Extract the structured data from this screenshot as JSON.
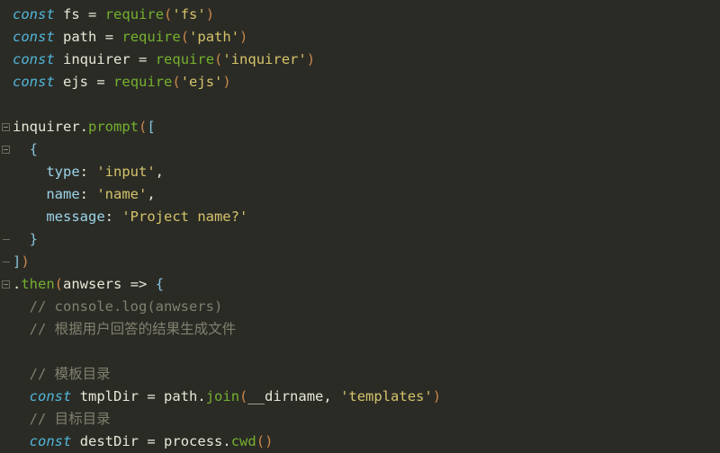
{
  "editor": {
    "language": "javascript",
    "theme_background": "#2b2b26",
    "default_text_color": "#e8e8d8",
    "font_size_px": 15.5,
    "line_height_px": 25,
    "colors": {
      "keyword": "#50b6d8",
      "function": "#74b12e",
      "string": "#d4c36a",
      "property": "#9bd4e8",
      "comment": "#80806f",
      "bracket_level_1": "#c8884a",
      "bracket_level_2": "#86c5e0",
      "fold_marker": "#6b6b60"
    }
  },
  "gutter": {
    "fold_markers": [
      {
        "name": "fold-marker-inquirer-prompt",
        "line": 6,
        "state": "expanded"
      },
      {
        "name": "fold-marker-object-literal",
        "line": 7,
        "state": "expanded"
      },
      {
        "name": "fold-marker-then-callback",
        "line": 13,
        "state": "expanded"
      }
    ],
    "fold_end_marks": [
      {
        "line": 11
      },
      {
        "line": 12
      }
    ]
  },
  "code": {
    "lines": [
      {
        "n": 1,
        "text": "const fs = require('fs')",
        "tokens": [
          {
            "t": "const",
            "c": "kw"
          },
          {
            "t": " ",
            "c": "plain"
          },
          {
            "t": "fs",
            "c": "plain"
          },
          {
            "t": " ",
            "c": "plain"
          },
          {
            "t": "=",
            "c": "op"
          },
          {
            "t": " ",
            "c": "plain"
          },
          {
            "t": "require",
            "c": "fn"
          },
          {
            "t": "(",
            "c": "paren1"
          },
          {
            "t": "'fs'",
            "c": "str"
          },
          {
            "t": ")",
            "c": "paren1"
          }
        ]
      },
      {
        "n": 2,
        "text": "const path = require('path')",
        "tokens": [
          {
            "t": "const",
            "c": "kw"
          },
          {
            "t": " ",
            "c": "plain"
          },
          {
            "t": "path",
            "c": "plain"
          },
          {
            "t": " ",
            "c": "plain"
          },
          {
            "t": "=",
            "c": "op"
          },
          {
            "t": " ",
            "c": "plain"
          },
          {
            "t": "require",
            "c": "fn"
          },
          {
            "t": "(",
            "c": "paren1"
          },
          {
            "t": "'path'",
            "c": "str"
          },
          {
            "t": ")",
            "c": "paren1"
          }
        ]
      },
      {
        "n": 3,
        "text": "const inquirer = require('inquirer')",
        "tokens": [
          {
            "t": "const",
            "c": "kw"
          },
          {
            "t": " ",
            "c": "plain"
          },
          {
            "t": "inquirer",
            "c": "plain"
          },
          {
            "t": " ",
            "c": "plain"
          },
          {
            "t": "=",
            "c": "op"
          },
          {
            "t": " ",
            "c": "plain"
          },
          {
            "t": "require",
            "c": "fn"
          },
          {
            "t": "(",
            "c": "paren1"
          },
          {
            "t": "'inquirer'",
            "c": "str"
          },
          {
            "t": ")",
            "c": "paren1"
          }
        ]
      },
      {
        "n": 4,
        "text": "const ejs = require('ejs')",
        "tokens": [
          {
            "t": "const",
            "c": "kw"
          },
          {
            "t": " ",
            "c": "plain"
          },
          {
            "t": "ejs",
            "c": "plain"
          },
          {
            "t": " ",
            "c": "plain"
          },
          {
            "t": "=",
            "c": "op"
          },
          {
            "t": " ",
            "c": "plain"
          },
          {
            "t": "require",
            "c": "fn"
          },
          {
            "t": "(",
            "c": "paren1"
          },
          {
            "t": "'ejs'",
            "c": "str"
          },
          {
            "t": ")",
            "c": "paren1"
          }
        ]
      },
      {
        "n": 5,
        "text": "",
        "tokens": []
      },
      {
        "n": 6,
        "text": "inquirer.prompt([",
        "tokens": [
          {
            "t": "inquirer",
            "c": "plain"
          },
          {
            "t": ".",
            "c": "plain"
          },
          {
            "t": "prompt",
            "c": "fn"
          },
          {
            "t": "(",
            "c": "paren1"
          },
          {
            "t": "[",
            "c": "paren2"
          }
        ]
      },
      {
        "n": 7,
        "text": "  {",
        "tokens": [
          {
            "t": "  ",
            "c": "plain"
          },
          {
            "t": "{",
            "c": "brace"
          }
        ]
      },
      {
        "n": 8,
        "text": "    type: 'input',",
        "tokens": [
          {
            "t": "    ",
            "c": "plain"
          },
          {
            "t": "type",
            "c": "prop"
          },
          {
            "t": ": ",
            "c": "plain"
          },
          {
            "t": "'input'",
            "c": "str"
          },
          {
            "t": ",",
            "c": "plain"
          }
        ]
      },
      {
        "n": 9,
        "text": "    name: 'name',",
        "tokens": [
          {
            "t": "    ",
            "c": "plain"
          },
          {
            "t": "name",
            "c": "prop"
          },
          {
            "t": ": ",
            "c": "plain"
          },
          {
            "t": "'name'",
            "c": "str"
          },
          {
            "t": ",",
            "c": "plain"
          }
        ]
      },
      {
        "n": 10,
        "text": "    message: 'Project name?'",
        "tokens": [
          {
            "t": "    ",
            "c": "plain"
          },
          {
            "t": "message",
            "c": "prop"
          },
          {
            "t": ": ",
            "c": "plain"
          },
          {
            "t": "'Project name?'",
            "c": "str"
          }
        ]
      },
      {
        "n": 11,
        "text": "  }",
        "tokens": [
          {
            "t": "  ",
            "c": "plain"
          },
          {
            "t": "}",
            "c": "brace"
          }
        ]
      },
      {
        "n": 12,
        "text": "])",
        "tokens": [
          {
            "t": "]",
            "c": "paren2"
          },
          {
            "t": ")",
            "c": "paren1"
          }
        ]
      },
      {
        "n": 13,
        "text": ".then(anwsers => {",
        "tokens": [
          {
            "t": ".",
            "c": "plain"
          },
          {
            "t": "then",
            "c": "fn"
          },
          {
            "t": "(",
            "c": "paren1"
          },
          {
            "t": "anwsers",
            "c": "plain"
          },
          {
            "t": " ",
            "c": "plain"
          },
          {
            "t": "=>",
            "c": "op"
          },
          {
            "t": " ",
            "c": "plain"
          },
          {
            "t": "{",
            "c": "brace"
          }
        ]
      },
      {
        "n": 14,
        "text": "  // console.log(anwsers)",
        "tokens": [
          {
            "t": "  ",
            "c": "plain"
          },
          {
            "t": "// console.log(anwsers)",
            "c": "comment"
          }
        ]
      },
      {
        "n": 15,
        "text": "  // 根据用户回答的结果生成文件",
        "tokens": [
          {
            "t": "  ",
            "c": "plain"
          },
          {
            "t": "// 根据用户回答的结果生成文件",
            "c": "comment"
          }
        ]
      },
      {
        "n": 16,
        "text": "",
        "tokens": []
      },
      {
        "n": 17,
        "text": "  // 模板目录",
        "tokens": [
          {
            "t": "  ",
            "c": "plain"
          },
          {
            "t": "// 模板目录",
            "c": "comment"
          }
        ]
      },
      {
        "n": 18,
        "text": "  const tmplDir = path.join(__dirname, 'templates')",
        "tokens": [
          {
            "t": "  ",
            "c": "plain"
          },
          {
            "t": "const",
            "c": "kw"
          },
          {
            "t": " ",
            "c": "plain"
          },
          {
            "t": "tmplDir",
            "c": "plain"
          },
          {
            "t": " ",
            "c": "plain"
          },
          {
            "t": "=",
            "c": "op"
          },
          {
            "t": " ",
            "c": "plain"
          },
          {
            "t": "path",
            "c": "plain"
          },
          {
            "t": ".",
            "c": "plain"
          },
          {
            "t": "join",
            "c": "fn"
          },
          {
            "t": "(",
            "c": "paren1"
          },
          {
            "t": "__dirname",
            "c": "plain"
          },
          {
            "t": ", ",
            "c": "plain"
          },
          {
            "t": "'templates'",
            "c": "str"
          },
          {
            "t": ")",
            "c": "paren1"
          }
        ]
      },
      {
        "n": 19,
        "text": "  // 目标目录",
        "tokens": [
          {
            "t": "  ",
            "c": "plain"
          },
          {
            "t": "// 目标目录",
            "c": "comment"
          }
        ]
      },
      {
        "n": 20,
        "text": "  const destDir = process.cwd()",
        "tokens": [
          {
            "t": "  ",
            "c": "plain"
          },
          {
            "t": "const",
            "c": "kw"
          },
          {
            "t": " ",
            "c": "plain"
          },
          {
            "t": "destDir",
            "c": "plain"
          },
          {
            "t": " ",
            "c": "plain"
          },
          {
            "t": "=",
            "c": "op"
          },
          {
            "t": " ",
            "c": "plain"
          },
          {
            "t": "process",
            "c": "plain"
          },
          {
            "t": ".",
            "c": "plain"
          },
          {
            "t": "cwd",
            "c": "fn"
          },
          {
            "t": "(",
            "c": "paren1"
          },
          {
            "t": ")",
            "c": "paren1"
          }
        ]
      }
    ]
  }
}
